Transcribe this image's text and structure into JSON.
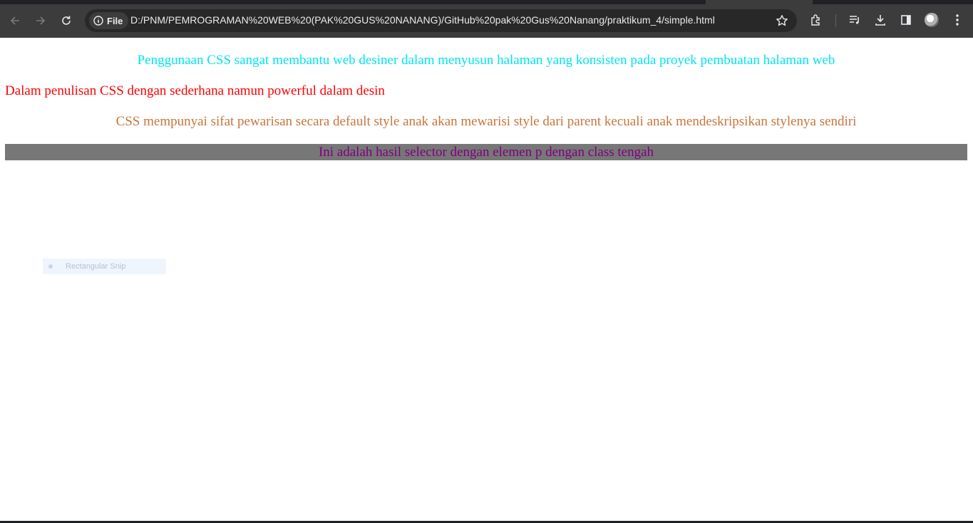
{
  "browser": {
    "chip_label": "File",
    "url": "D:/PNM/PEMROGRAMAN%20WEB%20(PAK%20GUS%20NANANG)/GitHub%20pak%20Gus%20Nanang/praktikum_4/simple.html",
    "icons": [
      "back-icon",
      "forward-icon",
      "reload-icon",
      "info-icon",
      "star-icon",
      "extensions-icon",
      "reading-list-icon",
      "download-icon",
      "side-panel-icon",
      "profile-avatar",
      "menu-icon"
    ],
    "colors": {
      "toolbar": "#3c3c3c",
      "omnibox": "#282828",
      "text": "#e8eaed"
    }
  },
  "page": {
    "paragraphs": [
      {
        "text": "Penggunaan CSS sangat membantu web desiner dalam menyusun halaman yang konsisten pada proyek pembuatan halaman web",
        "color": "#00e5ee",
        "align": "center"
      },
      {
        "text": "Dalam penulisan CSS dengan sederhana namun powerful dalam desin",
        "color": "#ff0000",
        "align": "left"
      },
      {
        "text": "CSS mempunyai sifat pewarisan secara default style anak akan mewarisi style dari parent kecuali anak mendeskripsikan stylenya sendiri",
        "color": "#c8753a",
        "align": "center"
      },
      {
        "text": "Ini adalah hasil selector dengan elemen p dengan class tengah",
        "color": "#800080",
        "background": "#777777",
        "align": "center"
      }
    ]
  },
  "overlay": {
    "snip_label": "Rectangular Snip"
  }
}
